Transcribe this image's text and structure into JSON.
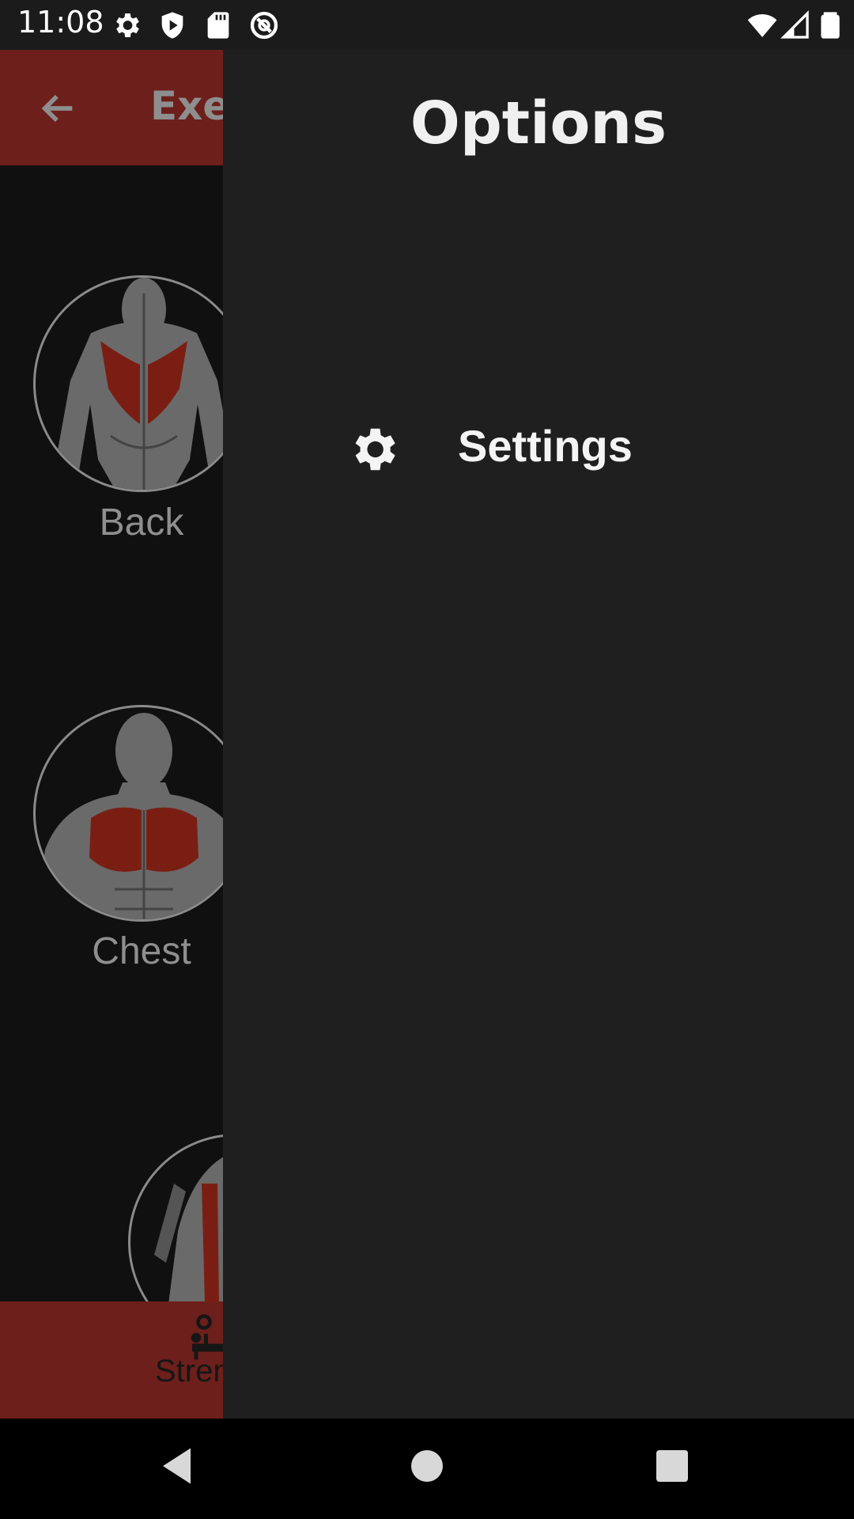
{
  "status_bar": {
    "time": "11:08",
    "left_icons": [
      "gear-icon",
      "shield-icon",
      "sd-card-icon",
      "data-saver-icon"
    ],
    "right_icons": [
      "wifi-icon",
      "signal-icon",
      "battery-icon"
    ]
  },
  "app": {
    "title": "Exe",
    "muscles": [
      {
        "label": "Back"
      },
      {
        "label": "Chest"
      },
      {
        "label": ""
      }
    ],
    "bottom_nav": {
      "label": "Stren"
    },
    "colors": {
      "accent": "#6d1f1b",
      "muscle_highlight": "#7a1e14"
    }
  },
  "drawer": {
    "title": "Options",
    "items": [
      {
        "label": "Settings",
        "icon": "gear-icon"
      }
    ]
  },
  "nav_bar": {
    "buttons": [
      "back-triangle-icon",
      "home-circle-icon",
      "recents-square-icon"
    ]
  }
}
